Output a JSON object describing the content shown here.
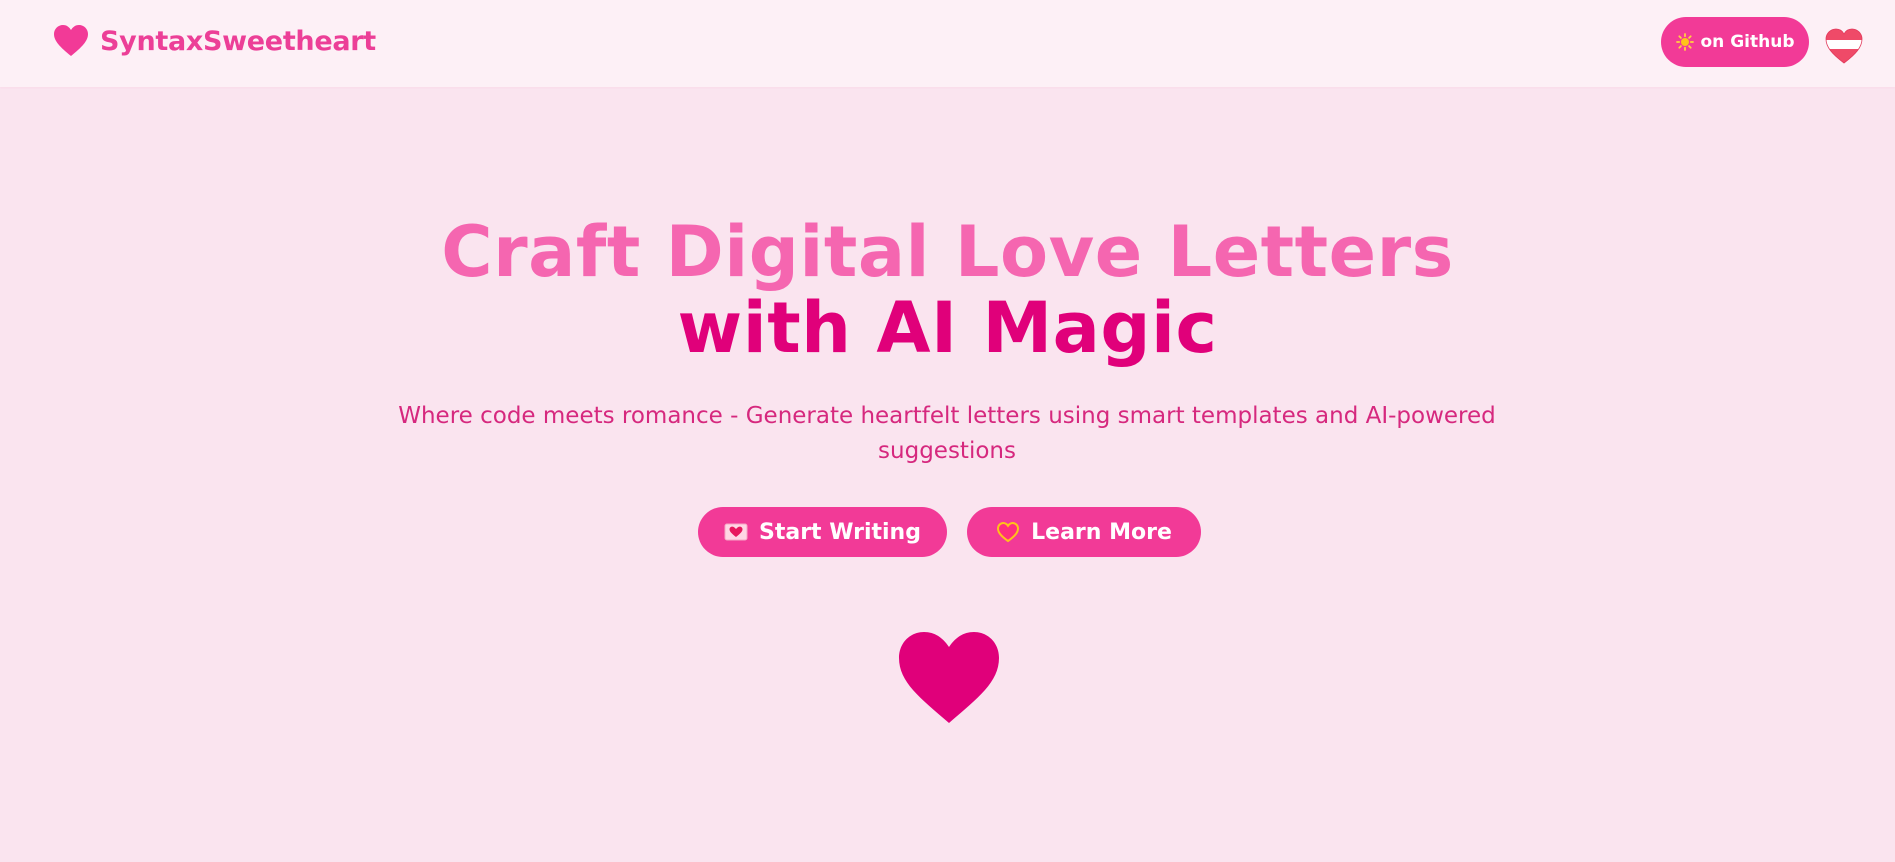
{
  "navbar": {
    "brand_icon": "heart-icon",
    "brand_name": "SyntaxSweetheart",
    "github_button": {
      "icon": "sun-icon",
      "label": "on Github"
    },
    "theme_toggle_icon": "heart-flag-icon"
  },
  "hero": {
    "title_line1": "Craft Digital Love Letters",
    "title_line2": "with AI Magic",
    "subtitle": "Where code meets romance - Generate heartfelt letters using smart templates and AI-powered suggestions",
    "buttons": [
      {
        "icon": "love-letter-icon",
        "label": "Start Writing"
      },
      {
        "icon": "heart-outline-icon",
        "label": "Learn More"
      }
    ],
    "decoration_icon": "heart-icon"
  },
  "colors": {
    "accent": "#f23a97",
    "brand_text": "#ec3f97",
    "title_light": "#f566b0",
    "title_dark": "#e0007a",
    "subtitle": "#d6287e",
    "page_background": "#fae4ef",
    "navbar_background": "#fdf0f6"
  }
}
